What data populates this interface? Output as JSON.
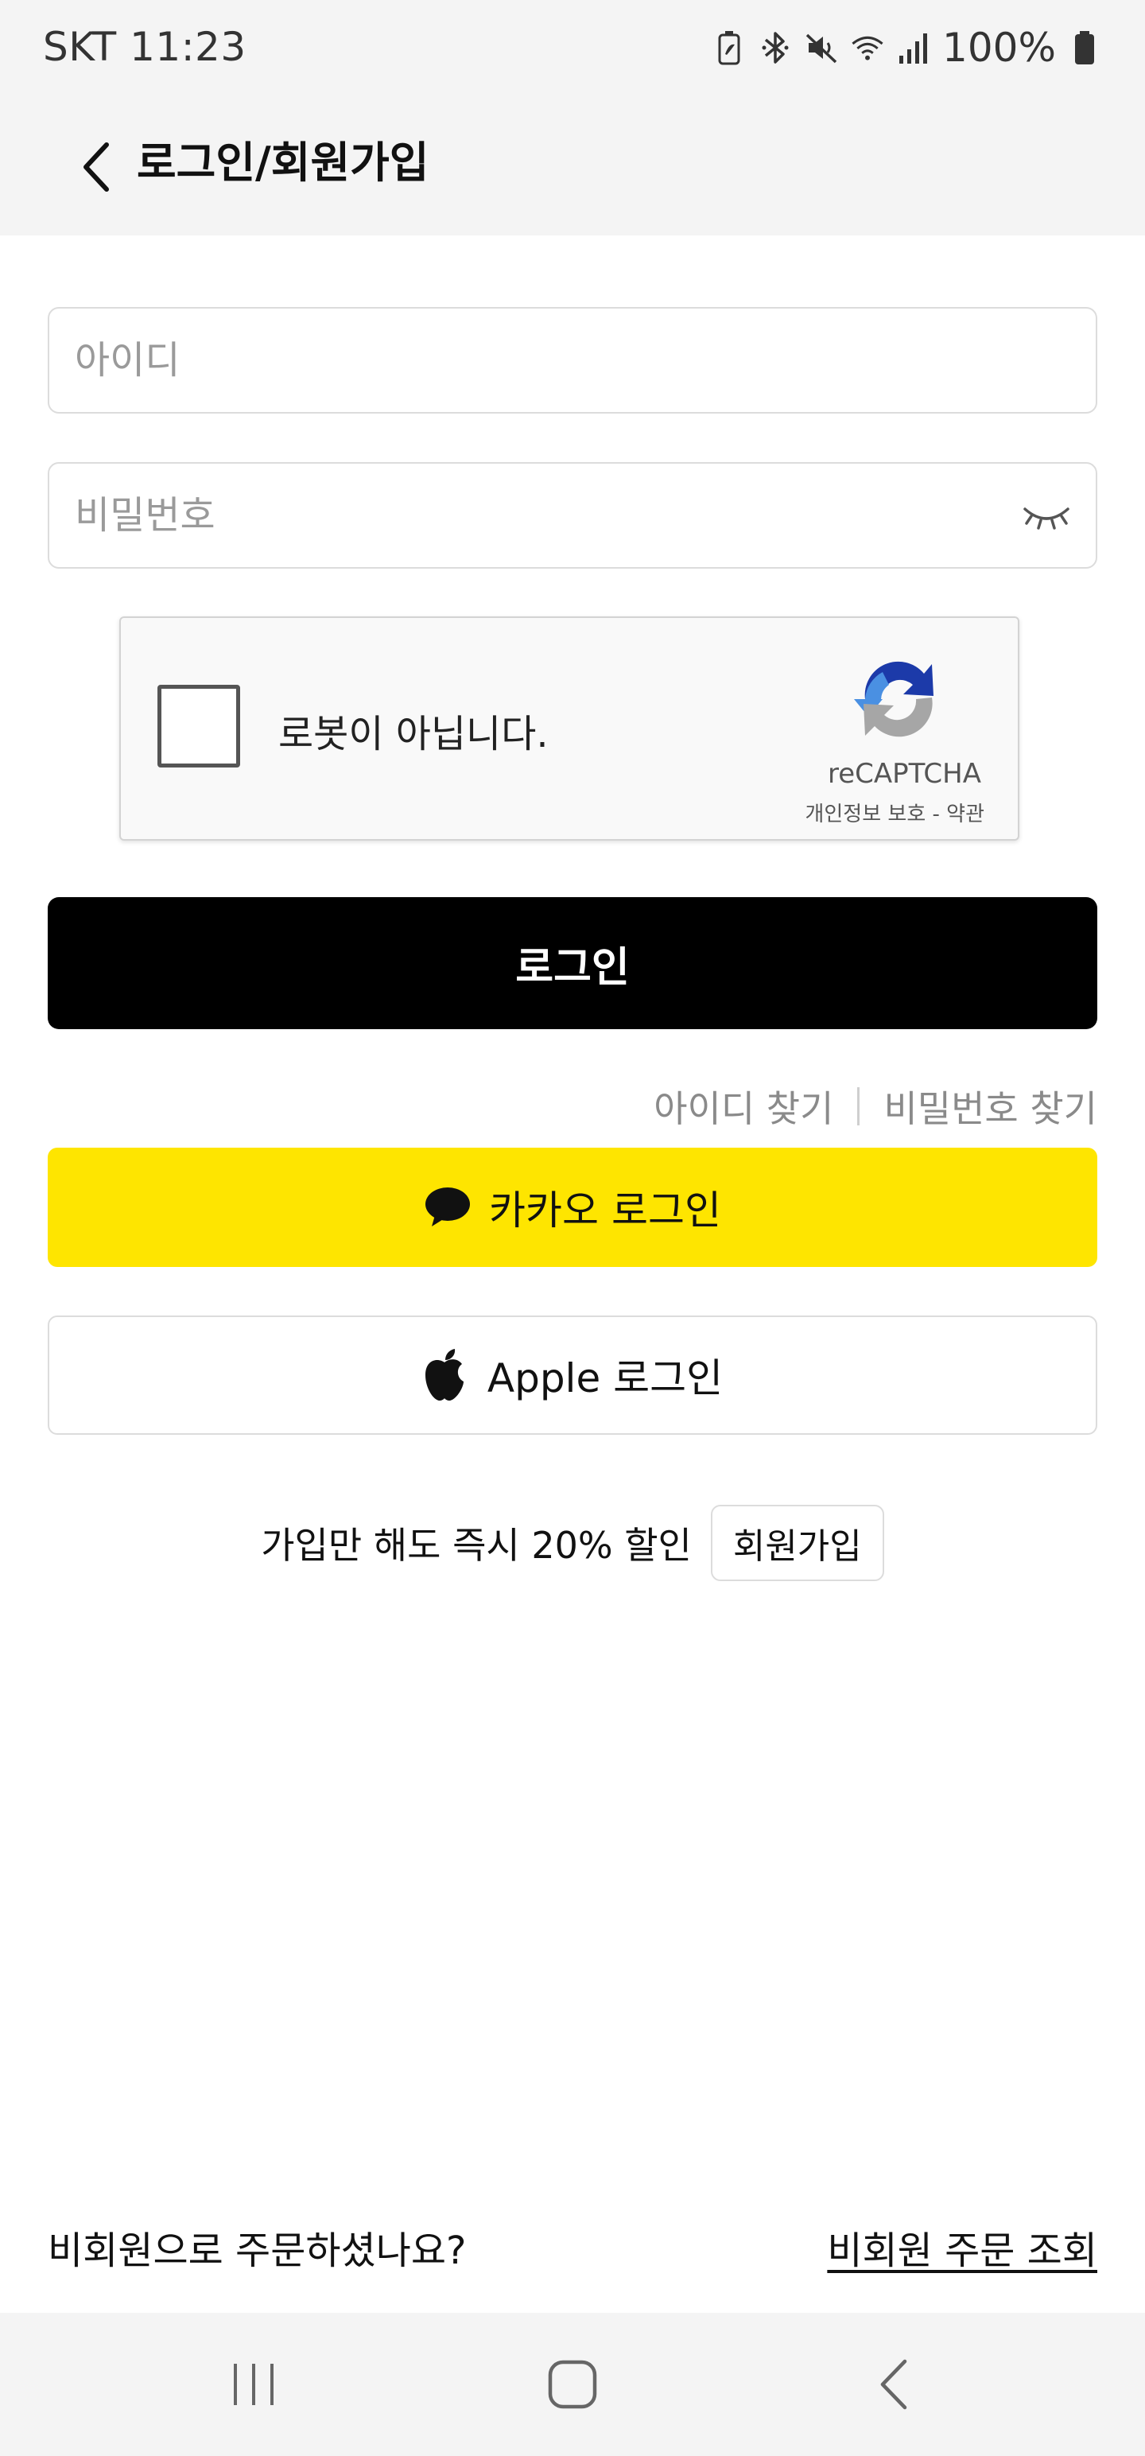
{
  "status_bar": {
    "carrier_time": "SKT 11:23",
    "battery": "100%",
    "icons": [
      "battery-saver-icon",
      "bluetooth-icon",
      "mute-icon",
      "wifi-icon",
      "signal-icon",
      "battery-icon"
    ]
  },
  "header": {
    "title": "로그인/회원가입",
    "back_icon": "chevron-left-icon"
  },
  "form": {
    "id_placeholder": "아이디",
    "id_value": "",
    "pw_placeholder": "비밀번호",
    "pw_value": "",
    "eye_icon": "eye-closed-icon"
  },
  "recaptcha": {
    "label": "로봇이 아닙니다.",
    "brand": "reCAPTCHA",
    "terms": "개인정보 보호 - 약관",
    "checked": false
  },
  "login_button": "로그인",
  "find_links": {
    "find_id": "아이디 찾기",
    "find_pw": "비밀번호 찾기"
  },
  "social": {
    "kakao_label": "카카오 로그인",
    "kakao_icon": "speech-bubble-icon",
    "apple_label": "Apple 로그인",
    "apple_icon": "apple-logo-icon"
  },
  "promo": {
    "text": "가입만 해도 즉시 20% 할인",
    "join_label": "회원가입"
  },
  "guest": {
    "question": "비회원으로 주문하셨나요?",
    "lookup_link": "비회원 주문 조회"
  },
  "colors": {
    "kakao_yellow": "#FEE500",
    "login_black": "#000000",
    "header_bg": "#F4F4F4"
  }
}
